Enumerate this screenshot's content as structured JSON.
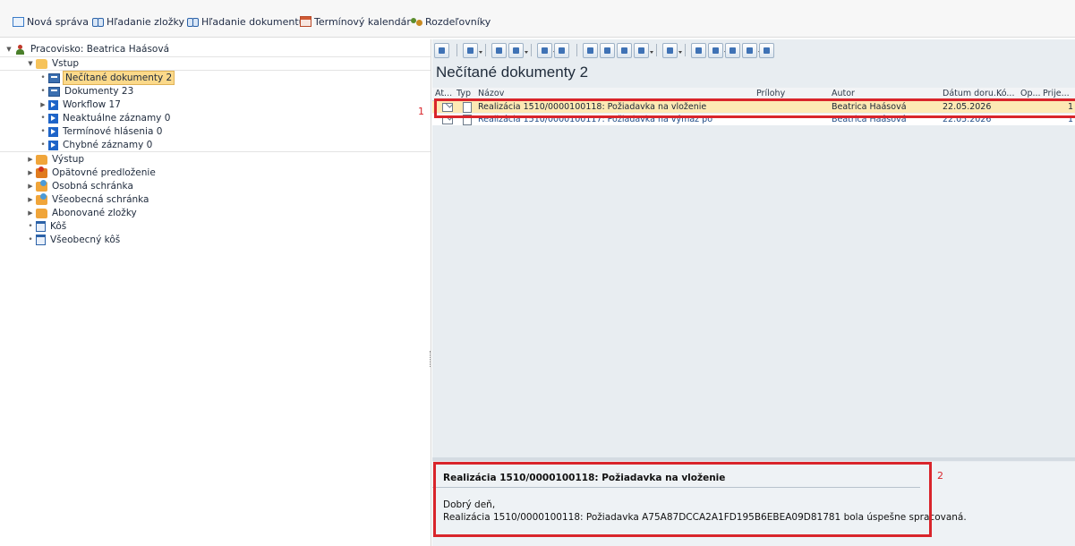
{
  "toolbar": {
    "items": [
      {
        "label": "Nová správa",
        "icon": "pen-icon"
      },
      {
        "label": "Hľadanie zložky",
        "icon": "binoculars-icon"
      },
      {
        "label": "Hľadanie dokumentu",
        "icon": "binoculars-icon"
      },
      {
        "label": "Termínový kalendár",
        "icon": "calendar-icon"
      },
      {
        "label": "Rozdeľovníky",
        "icon": "distribution-icon"
      }
    ]
  },
  "tree": {
    "root": "Pracovisko: Beatrica Haásová",
    "inbox": "Vstup",
    "inbox_items": [
      "Nečítané dokumenty 2",
      "Dokumenty 23",
      "Workflow 17",
      "Neaktuálne záznamy 0",
      "Termínové hlásenia 0",
      "Chybné záznamy 0"
    ],
    "folders": [
      "Výstup",
      "Opätovné predloženie",
      "Osobná schránka",
      "Všeobecná schránka",
      "Abonované zložky",
      "Kôš",
      "Všeobecný kôš"
    ]
  },
  "list": {
    "title": "Nečítané dokumenty 2",
    "columns": [
      "At...",
      "Typ",
      "Názov",
      "Prílohy",
      "Autor",
      "Dátum doru...",
      "Kó...",
      "Op...",
      "Prije..."
    ],
    "rows": [
      {
        "title": "Realizácia 1510/0000100118: Požiadavka na vloženie",
        "author": "Beatrica Haásová",
        "date": "22.05.2026",
        "count": "1"
      },
      {
        "title": "Realizácia 1510/0000100117: Požiadavka na výmaz po",
        "author": "Beatrica Haásová",
        "date": "22.05.2026",
        "count": "1"
      }
    ]
  },
  "preview": {
    "subject": "Realizácia 1510/0000100118: Požiadavka na vloženie",
    "greeting": "Dobrý deň,",
    "body": "Realizácia 1510/0000100118: Požiadavka A75A87DCCA2A1FD195B6EBEA09D81781 bola úspešne spracovaná."
  },
  "annotations": {
    "marker1": "1",
    "marker2": "2",
    "color": "#d9252b"
  },
  "colors": {
    "selected_row": "#fde9b4",
    "selected_tree": "#fbd98a",
    "pane_bg": "#e8edf1"
  }
}
